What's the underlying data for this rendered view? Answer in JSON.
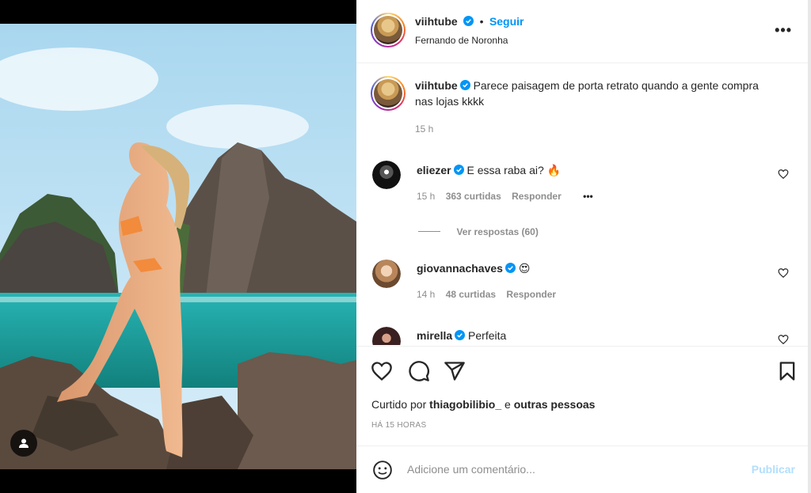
{
  "post": {
    "username": "viihtube",
    "follow_label": "Seguir",
    "separator": "•",
    "location": "Fernando de Noronha",
    "more_label": "•••"
  },
  "caption": {
    "username": "viihtube",
    "text": "Parece paisagem de porta retrato quando a gente compra nas lojas kkkk",
    "time": "15 h"
  },
  "comments": [
    {
      "username": "eliezer",
      "text": "E essa raba ai? 🔥",
      "time": "15 h",
      "likes": "363 curtidas",
      "reply": "Responder",
      "more": "•••"
    },
    {
      "username": "giovannachaves",
      "text": "😍",
      "time": "14 h",
      "likes": "48 curtidas",
      "reply": "Responder"
    },
    {
      "username": "mirella",
      "text": "Perfeita"
    }
  ],
  "view_replies": "Ver respostas (60)",
  "liked_by": {
    "prefix": "Curtido por",
    "user": "thiagobilibio_",
    "conj": "e",
    "others": "outras pessoas"
  },
  "timestamp": "HÁ 15 HORAS",
  "add_comment": {
    "placeholder": "Adicione um comentário...",
    "publish": "Publicar"
  },
  "icons": {
    "like": "heart-icon",
    "comment": "comment-icon",
    "share": "share-icon",
    "save": "bookmark-icon",
    "emoji": "emoji-icon",
    "user_tag": "user-tag-icon",
    "verified": "verified-badge-icon"
  },
  "colors": {
    "accent": "#0095f6",
    "verified": "#0095f6",
    "publish_disabled": "#b2dffc",
    "muted": "#8e8e8e"
  }
}
